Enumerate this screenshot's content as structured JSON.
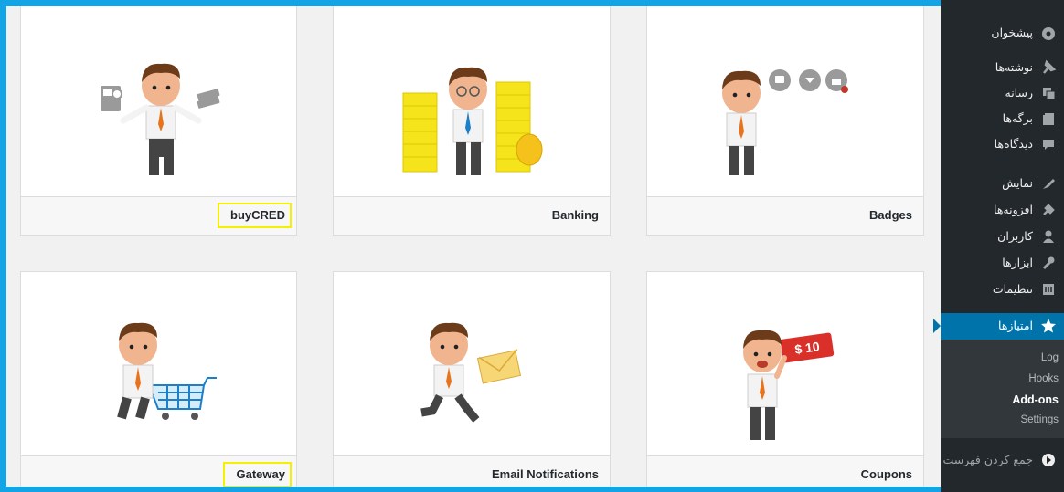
{
  "addons": [
    {
      "title": "buyCRED",
      "highlighted": true
    },
    {
      "title": "Banking",
      "highlighted": false
    },
    {
      "title": "Badges",
      "highlighted": false
    },
    {
      "title": "Gateway",
      "highlighted": true
    },
    {
      "title": "Email Notifications",
      "highlighted": false
    },
    {
      "title": "Coupons",
      "highlighted": false
    }
  ],
  "coupon_tag": "$ 10",
  "sidebar": {
    "items": [
      {
        "label": "پیشخوان",
        "icon": "dashboard-icon"
      },
      {
        "label": "نوشته‌ها",
        "icon": "pin-icon"
      },
      {
        "label": "رسانه",
        "icon": "media-icon"
      },
      {
        "label": "برگه‌ها",
        "icon": "pages-icon"
      },
      {
        "label": "دیدگاه‌ها",
        "icon": "comment-icon"
      },
      {
        "label": "نمایش",
        "icon": "appearance-icon"
      },
      {
        "label": "افزونه‌ها",
        "icon": "plugin-icon"
      },
      {
        "label": "کاربران",
        "icon": "users-icon"
      },
      {
        "label": "ابزارها",
        "icon": "tools-icon"
      },
      {
        "label": "تنظیمات",
        "icon": "settings-icon"
      },
      {
        "label": "امتیازها",
        "icon": "star-icon"
      },
      {
        "label": "جمع کردن فهرست",
        "icon": "collapse-icon"
      }
    ],
    "submenu": [
      "Log",
      "Hooks",
      "Add-ons",
      "Settings"
    ]
  },
  "colors": {
    "frame": "#13a4e6",
    "highlight": "#f4f000",
    "sidebar": "#23282d",
    "active": "#0073aa"
  }
}
